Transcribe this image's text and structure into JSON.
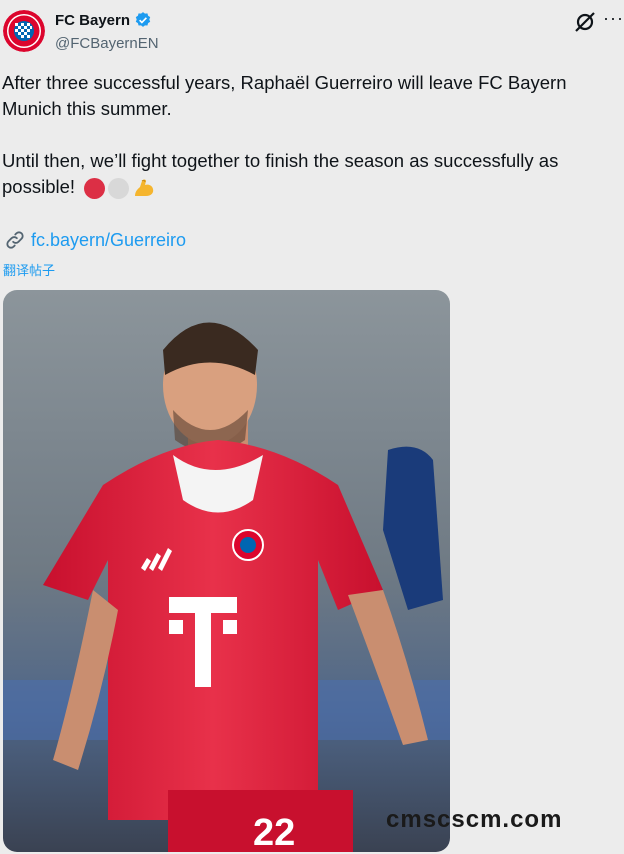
{
  "account": {
    "name": "FC Bayern",
    "handle": "@FCBayernEN",
    "avatar_icon": "fc-bayern-crest-icon",
    "verified_icon": "verified-badge-icon"
  },
  "tweet": {
    "paragraph1": "After three successful years, Raphaël Guerreiro will leave FC Bayern Munich this summer.",
    "paragraph2": "Until then, we’ll fight together to finish the season as successfully as possible!",
    "emojis": [
      "red-circle-emoji",
      "white-circle-emoji",
      "flexed-biceps-emoji"
    ],
    "link_icon": "link-icon",
    "link_text": "fc.bayern/Guerreiro",
    "translate_label": "翻译帖子"
  },
  "toolbar": {
    "grok_icon": "grok-icon",
    "more_label": "···"
  },
  "photo": {
    "description_icon": "player-photo",
    "jersey_number": "22"
  },
  "watermark": "cmscscm.com",
  "colors": {
    "link": "#1d9bf0",
    "verified": "#1d9bf0",
    "bayern_red": "#dc052d",
    "background": "#ececec"
  }
}
